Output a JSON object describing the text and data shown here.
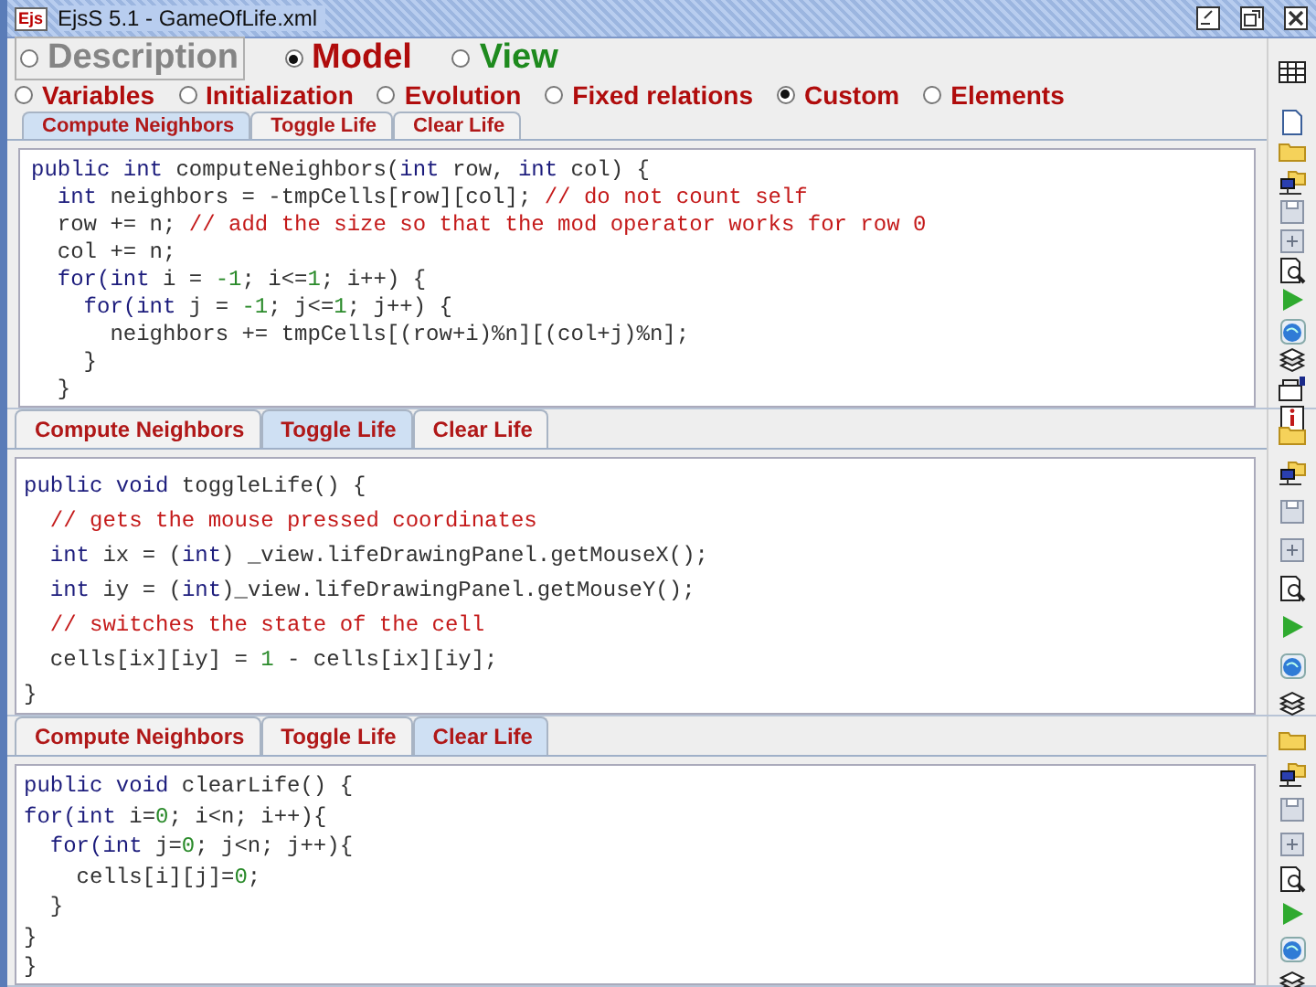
{
  "window": {
    "title": "EjsS 5.1 - GameOfLife.xml",
    "app_icon_text": "Ejs"
  },
  "modes": [
    {
      "label": "Description",
      "selected": false,
      "focused": true,
      "color": "#858585"
    },
    {
      "label": "Model",
      "selected": true,
      "focused": false,
      "color": "#b00c0c"
    },
    {
      "label": "View",
      "selected": false,
      "focused": false,
      "color": "#1e8a1e"
    }
  ],
  "model_sections": [
    {
      "label": "Variables",
      "selected": false
    },
    {
      "label": "Initialization",
      "selected": false
    },
    {
      "label": "Evolution",
      "selected": false
    },
    {
      "label": "Fixed relations",
      "selected": false
    },
    {
      "label": "Custom",
      "selected": true
    },
    {
      "label": "Elements",
      "selected": false
    }
  ],
  "panels": [
    {
      "tabs": [
        {
          "label": "Compute Neighbors",
          "selected": true
        },
        {
          "label": "Toggle Life",
          "selected": false
        },
        {
          "label": "Clear Life",
          "selected": false
        }
      ],
      "code": [
        [
          {
            "kind": "keyword",
            "text": "public int"
          },
          {
            "kind": "plain",
            "text": " computeNeighbors("
          },
          {
            "kind": "keyword",
            "text": "int"
          },
          {
            "kind": "plain",
            "text": " row, "
          },
          {
            "kind": "keyword",
            "text": "int"
          },
          {
            "kind": "plain",
            "text": " col) {"
          }
        ],
        [
          {
            "kind": "keyword",
            "text": "  int"
          },
          {
            "kind": "plain",
            "text": " neighbors = -tmpCells[row][col]; "
          },
          {
            "kind": "comment",
            "text": "// do not count self"
          }
        ],
        [
          {
            "kind": "plain",
            "text": "  row += n; "
          },
          {
            "kind": "comment",
            "text": "// add the size so that the mod operator works for row 0"
          }
        ],
        [
          {
            "kind": "plain",
            "text": "  col += n;"
          }
        ],
        [
          {
            "kind": "keyword",
            "text": "  for(int"
          },
          {
            "kind": "plain",
            "text": " i = "
          },
          {
            "kind": "number",
            "text": "-1"
          },
          {
            "kind": "plain",
            "text": "; i<="
          },
          {
            "kind": "number",
            "text": "1"
          },
          {
            "kind": "plain",
            "text": "; i++) {"
          }
        ],
        [
          {
            "kind": "keyword",
            "text": "    for(int"
          },
          {
            "kind": "plain",
            "text": " j = "
          },
          {
            "kind": "number",
            "text": "-1"
          },
          {
            "kind": "plain",
            "text": "; j<="
          },
          {
            "kind": "number",
            "text": "1"
          },
          {
            "kind": "plain",
            "text": "; j++) {"
          }
        ],
        [
          {
            "kind": "plain",
            "text": "      neighbors += tmpCells[(row+i)%n][(col+j)%n];"
          }
        ],
        [
          {
            "kind": "plain",
            "text": "    }"
          }
        ],
        [
          {
            "kind": "plain",
            "text": "  }"
          }
        ]
      ]
    },
    {
      "tabs": [
        {
          "label": "Compute Neighbors",
          "selected": false
        },
        {
          "label": "Toggle Life",
          "selected": true
        },
        {
          "label": "Clear Life",
          "selected": false
        }
      ],
      "code": [
        [
          {
            "kind": "keyword",
            "text": "public void"
          },
          {
            "kind": "plain",
            "text": " toggleLife() {"
          }
        ],
        [
          {
            "kind": "comment",
            "text": "  // gets the mouse pressed coordinates"
          }
        ],
        [
          {
            "kind": "keyword",
            "text": "  int"
          },
          {
            "kind": "plain",
            "text": " ix = ("
          },
          {
            "kind": "keyword",
            "text": "int"
          },
          {
            "kind": "plain",
            "text": ") _view.lifeDrawingPanel.getMouseX();"
          }
        ],
        [
          {
            "kind": "keyword",
            "text": "  int"
          },
          {
            "kind": "plain",
            "text": " iy = ("
          },
          {
            "kind": "keyword",
            "text": "int"
          },
          {
            "kind": "plain",
            "text": ")_view.lifeDrawingPanel.getMouseY();"
          }
        ],
        [
          {
            "kind": "comment",
            "text": "  // switches the state of the cell"
          }
        ],
        [
          {
            "kind": "plain",
            "text": "  cells[ix][iy] = "
          },
          {
            "kind": "number",
            "text": "1"
          },
          {
            "kind": "plain",
            "text": " - cells[ix][iy];"
          }
        ],
        [
          {
            "kind": "plain",
            "text": "}"
          }
        ]
      ]
    },
    {
      "tabs": [
        {
          "label": "Compute Neighbors",
          "selected": false
        },
        {
          "label": "Toggle Life",
          "selected": false
        },
        {
          "label": "Clear Life",
          "selected": true
        }
      ],
      "code": [
        [
          {
            "kind": "keyword",
            "text": "public void"
          },
          {
            "kind": "plain",
            "text": " clearLife() {"
          }
        ],
        [
          {
            "kind": "keyword",
            "text": "for(int"
          },
          {
            "kind": "plain",
            "text": " i="
          },
          {
            "kind": "number",
            "text": "0"
          },
          {
            "kind": "plain",
            "text": "; i<n; i++){"
          }
        ],
        [
          {
            "kind": "keyword",
            "text": "  for(int"
          },
          {
            "kind": "plain",
            "text": " j="
          },
          {
            "kind": "number",
            "text": "0"
          },
          {
            "kind": "plain",
            "text": "; j<n; j++){"
          }
        ],
        [
          {
            "kind": "plain",
            "text": "    cells[i][j]="
          },
          {
            "kind": "number",
            "text": "0"
          },
          {
            "kind": "plain",
            "text": ";"
          }
        ],
        [
          {
            "kind": "plain",
            "text": "  }"
          }
        ],
        [
          {
            "kind": "plain",
            "text": "}"
          }
        ],
        [
          {
            "kind": "plain",
            "text": "}"
          }
        ]
      ]
    }
  ]
}
